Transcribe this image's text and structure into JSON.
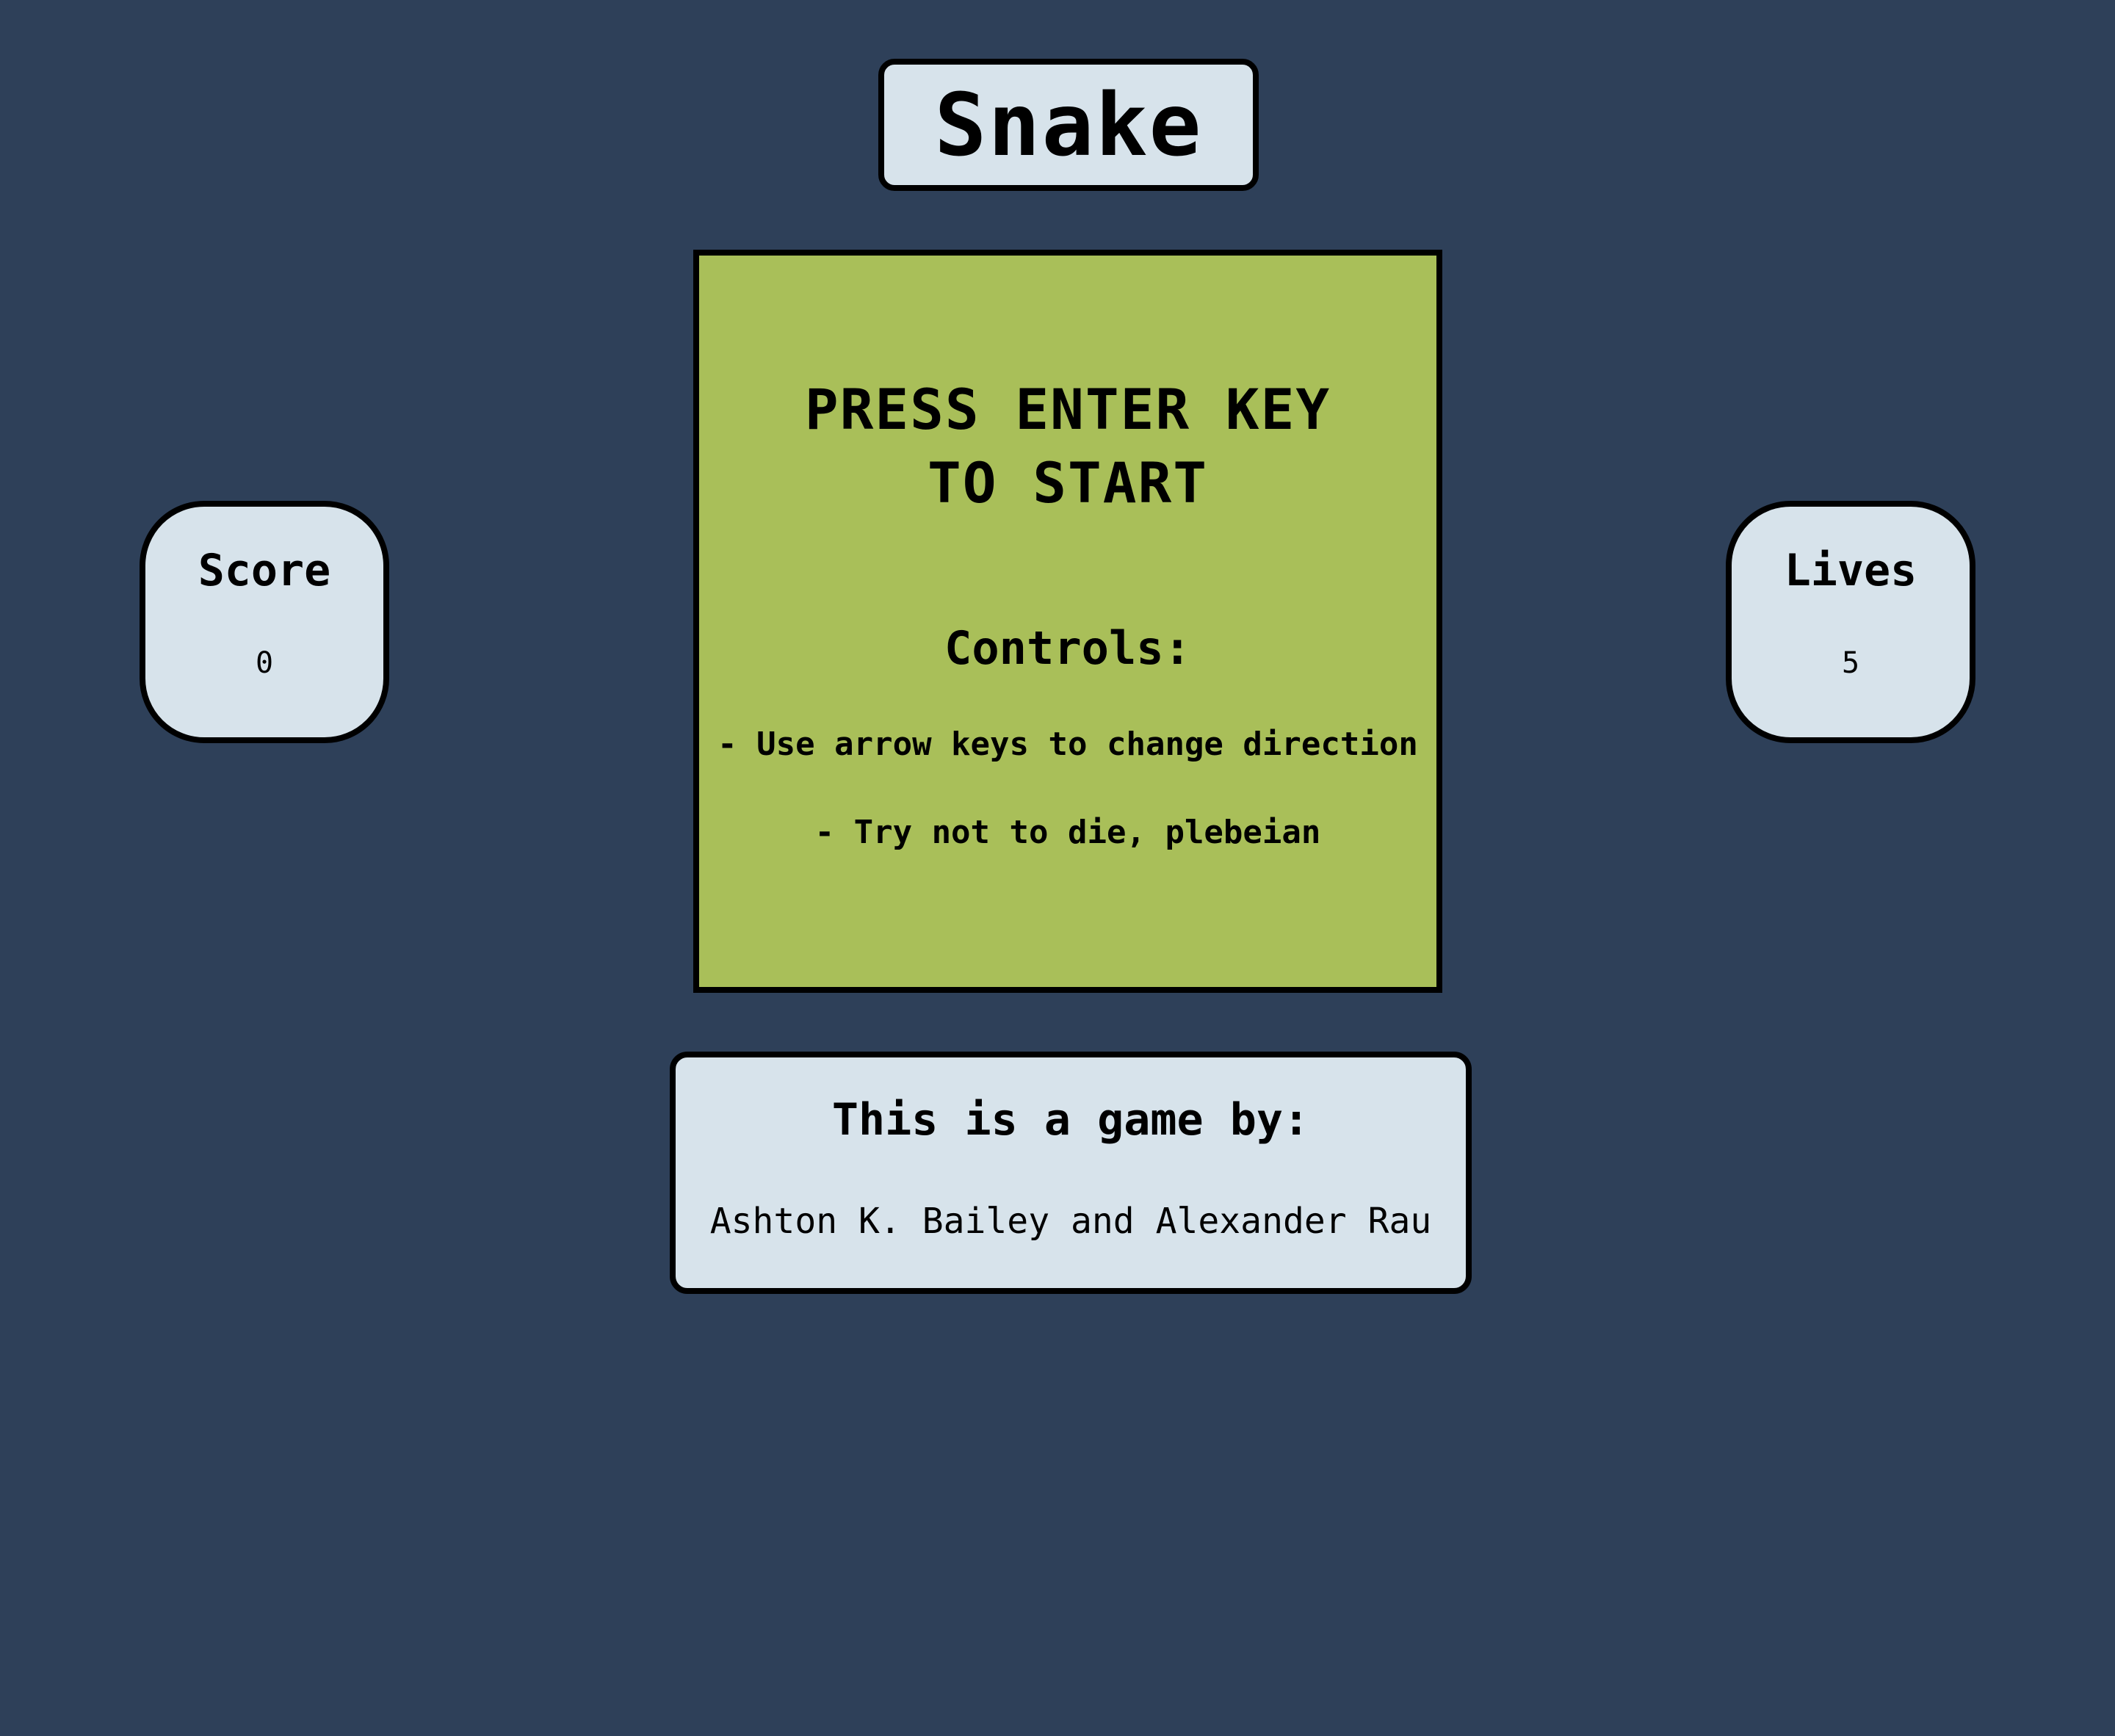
{
  "title": "Snake",
  "score": {
    "label": "Score",
    "value": "0"
  },
  "lives": {
    "label": "Lives",
    "value": "5"
  },
  "board": {
    "prompt_line1": "PRESS ENTER KEY",
    "prompt_line2": "TO START",
    "controls_heading": "Controls:",
    "controls": [
      "- Use arrow keys to change direction",
      "- Try not to die, plebeian"
    ]
  },
  "credits": {
    "heading": "This is a game by:",
    "authors": "Ashton K. Bailey and Alexander Rau"
  },
  "colors": {
    "background": "#2e4059",
    "panel": "#d7e3eb",
    "board": "#a9bf59",
    "border": "#000000"
  }
}
